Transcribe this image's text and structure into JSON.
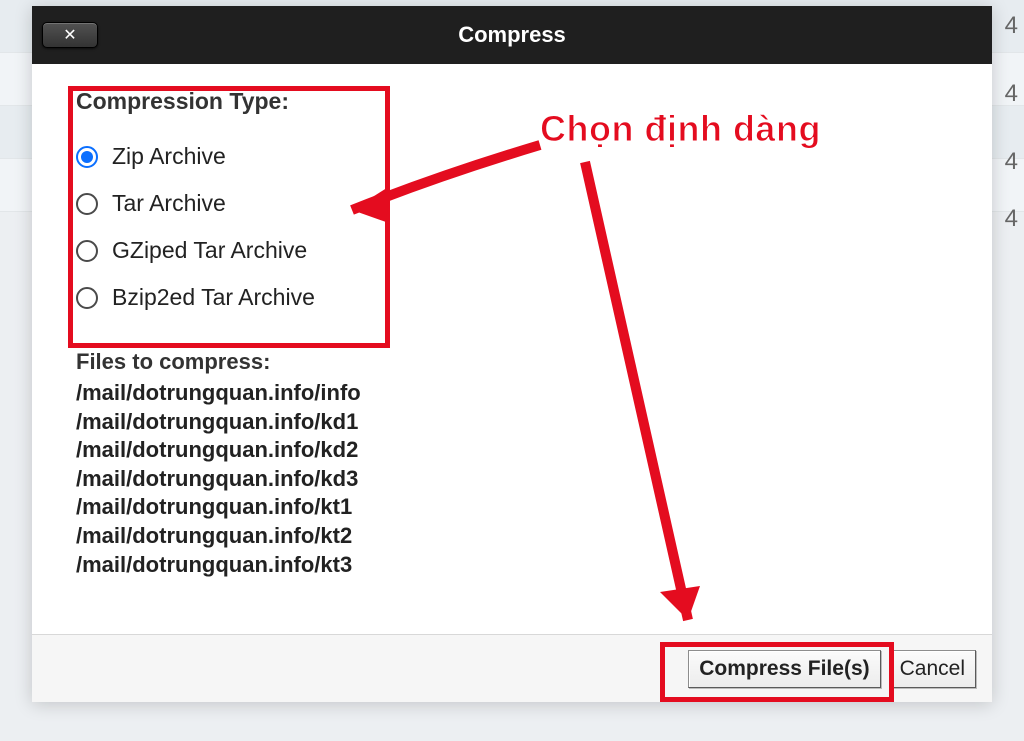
{
  "background_numbers": [
    "4",
    "4",
    "4",
    "4"
  ],
  "dialog": {
    "title": "Compress",
    "close_symbol": "✕",
    "compression_type_label": "Compression Type:",
    "options": [
      {
        "label": "Zip Archive",
        "checked": true
      },
      {
        "label": "Tar Archive",
        "checked": false
      },
      {
        "label": "GZiped Tar Archive",
        "checked": false
      },
      {
        "label": "Bzip2ed Tar Archive",
        "checked": false
      }
    ],
    "files_label": "Files to compress:",
    "files": [
      "/mail/dotrungquan.info/info",
      "/mail/dotrungquan.info/kd1",
      "/mail/dotrungquan.info/kd2",
      "/mail/dotrungquan.info/kd3",
      "/mail/dotrungquan.info/kt1",
      "/mail/dotrungquan.info/kt2",
      "/mail/dotrungquan.info/kt3"
    ],
    "buttons": {
      "compress": "Compress File(s)",
      "cancel": "Cancel"
    }
  },
  "annotation": {
    "text": "Chọn định dàng",
    "color": "#e40c1f"
  }
}
